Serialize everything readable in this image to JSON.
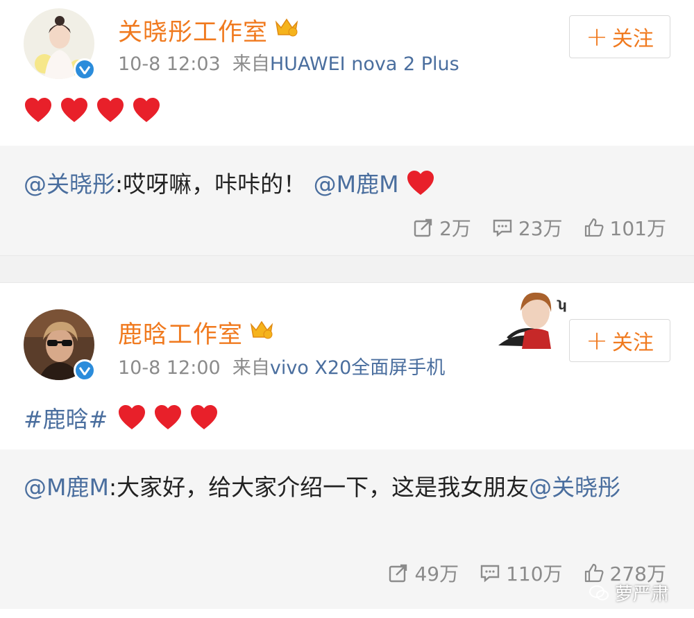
{
  "posts": [
    {
      "author": "关晓彤工作室",
      "time": "10-8 12:03",
      "source_prefix": "来自",
      "source": "HUAWEI nova 2 Plus",
      "follow_label": "关注",
      "heart_count": 4,
      "repost": {
        "mention": "@关晓彤",
        "text": ":哎呀嘛，咔咔的！",
        "mention2": "@M鹿M"
      },
      "stats": {
        "shares": "2万",
        "comments": "23万",
        "likes": "101万"
      }
    },
    {
      "author": "鹿晗工作室",
      "time": "10-8 12:00",
      "source_prefix": "来自",
      "source": "vivo X20全面屏手机",
      "follow_label": "关注",
      "hashtag": "#鹿晗#",
      "heart_count": 3,
      "repost": {
        "mention": "@M鹿M",
        "text": ":大家好，给大家介绍一下，这是我女朋友",
        "mention2": "@关晓彤"
      },
      "stats": {
        "shares": "49万",
        "comments": "110万",
        "likes": "278万"
      }
    }
  ],
  "watermark": "萝严肃",
  "colors": {
    "name": "#f07a1f",
    "link": "#4a6e9e",
    "meta": "#8b8b8b",
    "heart": "#e8202a",
    "verified": "#2b8cdb"
  }
}
